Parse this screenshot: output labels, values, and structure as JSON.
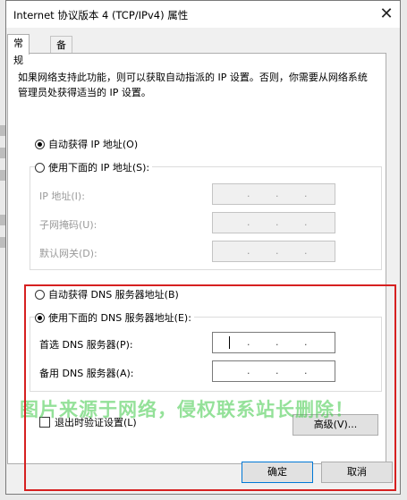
{
  "window": {
    "title": "Internet 协议版本 4 (TCP/IPv4) 属性",
    "close_glyph": "✕"
  },
  "tabs": [
    {
      "label": "常规"
    },
    {
      "label": "备用配置"
    }
  ],
  "description": "如果网络支持此功能，则可以获取自动指派的 IP 设置。否则，你需要从网络系统管理员处获得适当的 IP 设置。",
  "ip": {
    "auto_label": "自动获得 IP 地址(O)",
    "manual_label": "使用下面的 IP 地址(S):",
    "selected": "auto",
    "fields": [
      {
        "label": "IP 地址(I):"
      },
      {
        "label": "子网掩码(U):"
      },
      {
        "label": "默认网关(D):"
      }
    ]
  },
  "dns": {
    "auto_label": "自动获得 DNS 服务器地址(B)",
    "manual_label": "使用下面的 DNS 服务器地址(E):",
    "selected": "manual",
    "fields": [
      {
        "label": "首选 DNS 服务器(P):"
      },
      {
        "label": "备用 DNS 服务器(A):"
      }
    ]
  },
  "validate_label": "退出时验证设置(L)",
  "advanced_label": "高级(V)...",
  "ok_label": "确定",
  "cancel_label": "取消",
  "ip_dot": ".",
  "watermark": "图片来源于网络，侵权联系站长删除！",
  "colors": {
    "highlight_box": "#d62020",
    "watermark": "#3cc846",
    "focus_border": "#0078d7"
  }
}
